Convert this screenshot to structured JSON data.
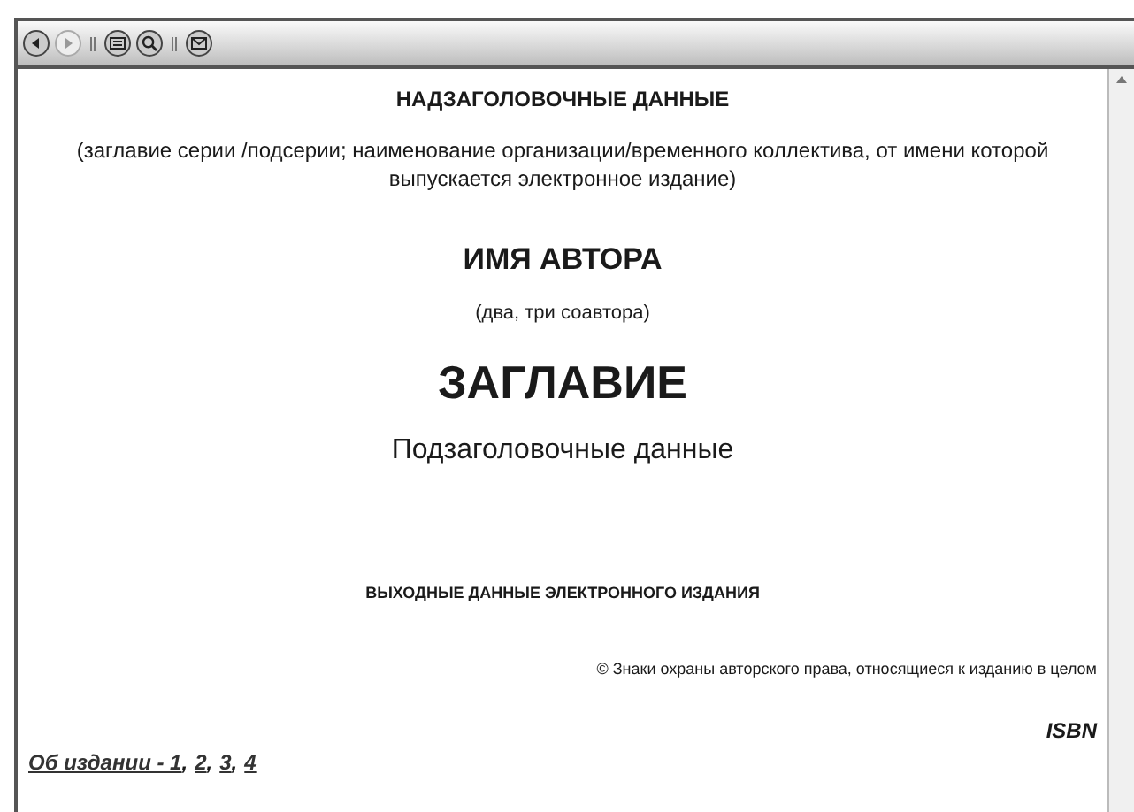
{
  "toolbar": {
    "groups": [
      [
        {
          "kind": "back",
          "disabled": false
        },
        {
          "kind": "forward",
          "disabled": true
        }
      ],
      [
        {
          "kind": "contents",
          "disabled": false
        },
        {
          "kind": "search",
          "disabled": false
        }
      ],
      [
        {
          "kind": "mail",
          "disabled": false
        }
      ]
    ]
  },
  "page": {
    "header": "НАДЗАГОЛОВОЧНЫЕ ДАННЫЕ",
    "series_note": "(заглавие серии /подсерии; наименование организации/временного коллектива, от имени которой выпускается электронное издание)",
    "author": "ИМЯ АВТОРА",
    "coauthors": "(два, три соавтора)",
    "title": "ЗАГЛАВИЕ",
    "subtitle": "Подзаголовочные данные",
    "imprint": "ВЫХОДНЫЕ ДАННЫЕ ЭЛЕКТРОННОГО ИЗДАНИЯ",
    "copyright": "© Знаки охраны авторского права, относящиеся к изданию в целом",
    "isbn": "ISBN",
    "about": {
      "separator": ",",
      "links": [
        {
          "text": "Об издании - 1"
        },
        {
          "text": "2"
        },
        {
          "text": "3"
        },
        {
          "text": "4"
        }
      ]
    }
  }
}
